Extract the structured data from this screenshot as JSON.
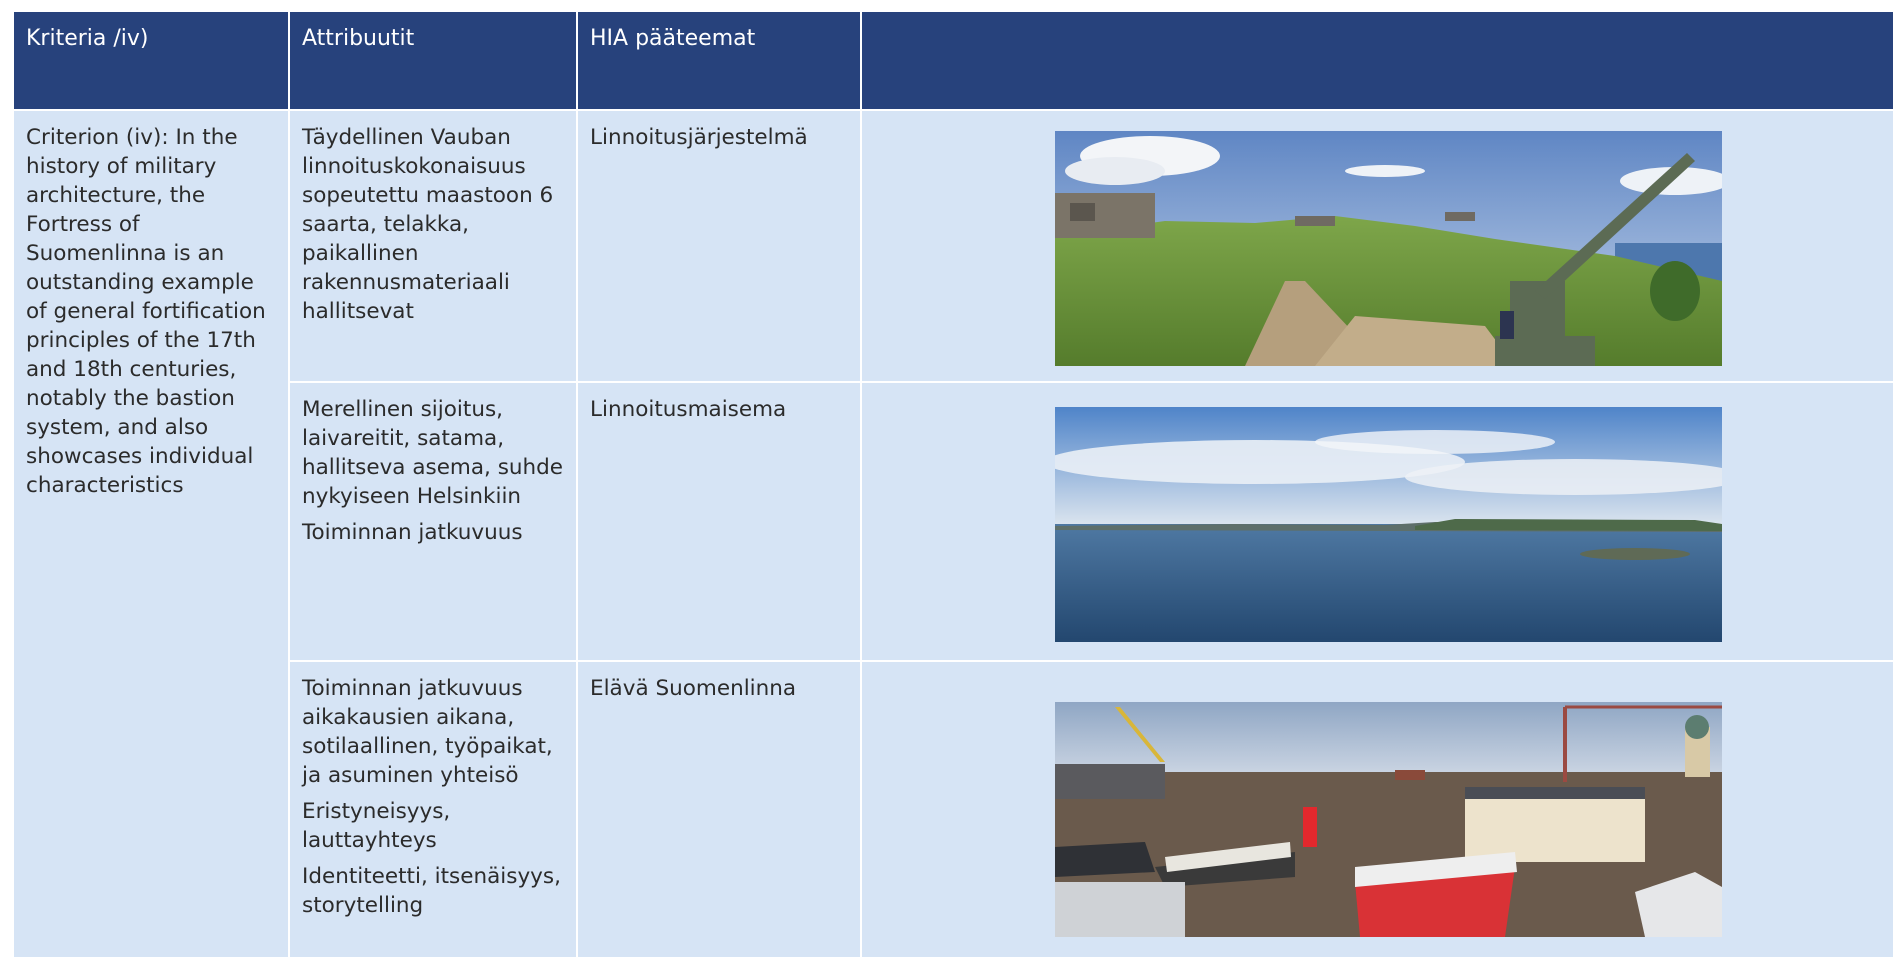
{
  "header": {
    "col1": "Kriteria /iv)",
    "col2": "Attribuutit",
    "col3": "HIA pääteemat",
    "col4": ""
  },
  "criterion": "Criterion (iv): In the history of military architecture, the Fortress of Suomenlinna is an outstanding example of general fortification principles of the 17th and 18th centuries, notably the bastion system, and also showcases individual characteristics",
  "rows": [
    {
      "attributes": [
        "Täydellinen Vauban linnoituskokonaisuus sopeutettu maastoon 6 saarta, telakka, paikallinen rakennusmateriaali hallitsevat"
      ],
      "theme": "Linnoitusjärjestelmä",
      "image": "fortress-cannon-photo"
    },
    {
      "attributes": [
        "Merellinen sijoitus, laivareitit, satama, hallitseva asema, suhde nykyiseen Helsinkiin",
        "Toiminnan jatkuvuus"
      ],
      "theme": "Linnoitusmaisema",
      "image": "sea-landscape-photo"
    },
    {
      "attributes": [
        "Toiminnan jatkuvuus aikakausien aikana, sotilaallinen, työpaikat, ja asuminen yhteisö",
        "Eristyneisyys, lauttayhteys",
        "Identiteetti, itsenäisyys, storytelling"
      ],
      "theme": "Elävä Suomenlinna",
      "image": "shipyard-photo"
    }
  ],
  "colors": {
    "header_bg": "#27427c",
    "cell_bg": "#d6e4f5",
    "grid": "#ffffff"
  }
}
